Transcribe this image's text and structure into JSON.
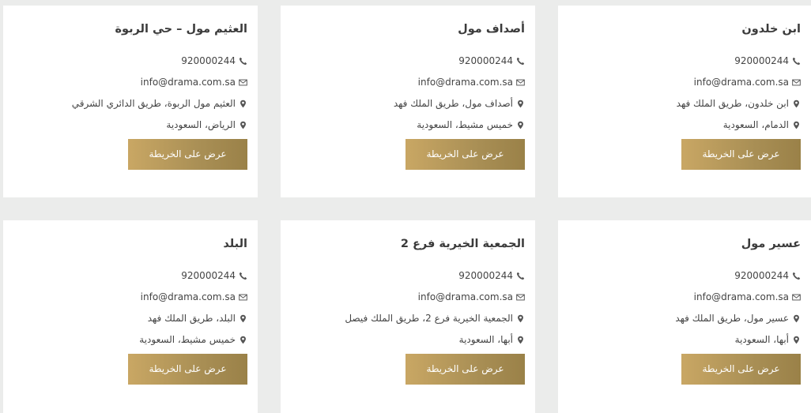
{
  "colors": {
    "background": "#ebeceb",
    "card": "#ffffff",
    "title": "#3b3b3b",
    "text": "#444444",
    "button_start": "#c9a764",
    "button_end": "#9a8148"
  },
  "icons": {
    "phone": "phone-icon",
    "email": "envelope-icon",
    "location": "map-marker-icon"
  },
  "cards": [
    {
      "title": "ابن خلدون",
      "phone": "920000244",
      "email": "info@drama.com.sa",
      "address": "ابن خلدون، طريق الملك فهد",
      "city": "الدمام، السعودية",
      "button": "عرض على الخريطة"
    },
    {
      "title": "أصداف مول",
      "phone": "920000244",
      "email": "info@drama.com.sa",
      "address": "أصداف مول، طريق الملك فهد",
      "city": "خميس مشيط، السعودية",
      "button": "عرض على الخريطة"
    },
    {
      "title": "العثيم مول – حي الربوة",
      "phone": "920000244",
      "email": "info@drama.com.sa",
      "address": "العثيم مول الربوة، طريق الدائري الشرقي",
      "city": "الرياض، السعودية",
      "button": "عرض على الخريطة"
    },
    {
      "title": "عسير مول",
      "phone": "920000244",
      "email": "info@drama.com.sa",
      "address": "عسير مول، طريق الملك فهد",
      "city": "أبها، السعودية",
      "button": "عرض على الخريطة"
    },
    {
      "title": "الجمعية الخيرية فرع 2",
      "phone": "920000244",
      "email": "info@drama.com.sa",
      "address": "الجمعية الخيرية فرع 2، طريق الملك فيصل",
      "city": "أبها، السعودية",
      "button": "عرض على الخريطة"
    },
    {
      "title": "البلد",
      "phone": "920000244",
      "email": "info@drama.com.sa",
      "address": "البلد، طريق الملك فهد",
      "city": "خميس مشيط، السعودية",
      "button": "عرض على الخريطة"
    }
  ]
}
